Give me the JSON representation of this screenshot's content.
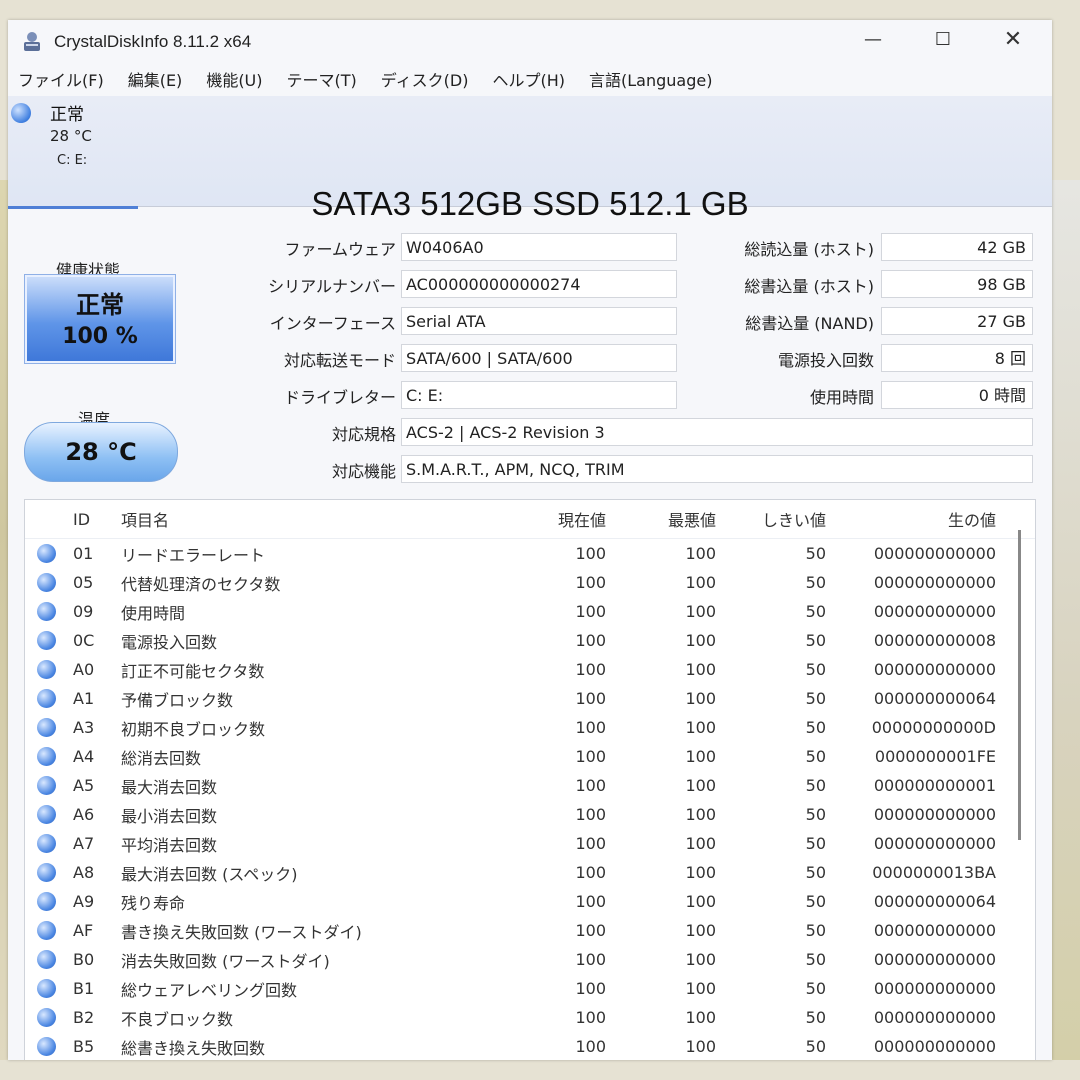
{
  "window": {
    "title": "CrystalDiskInfo 8.11.2 x64",
    "minimize": "—",
    "maximize": "☐",
    "close": "✕"
  },
  "menu": [
    "ファイル(F)",
    "編集(E)",
    "機能(U)",
    "テーマ(T)",
    "ディスク(D)",
    "ヘルプ(H)",
    "言語(Language)"
  ],
  "disk_tab": {
    "status": "正常",
    "temp": "28 °C",
    "letters": "C: E:"
  },
  "model": "SATA3 512GB SSD 512.1 GB",
  "health": {
    "label": "健康状態",
    "status": "正常",
    "percent": "100 %"
  },
  "temperature": {
    "label": "温度",
    "value": "28 °C"
  },
  "info_left": {
    "firmware_label": "ファームウェア",
    "firmware": "W0406A0",
    "serial_label": "シリアルナンバー",
    "serial": "AC000000000000274",
    "interface_label": "インターフェース",
    "interface": "Serial ATA",
    "transfer_label": "対応転送モード",
    "transfer": "SATA/600 | SATA/600",
    "drive_label": "ドライブレター",
    "drive": "C: E:",
    "standard_label": "対応規格",
    "standard": "ACS-2 | ACS-2 Revision 3",
    "features_label": "対応機能",
    "features": "S.M.A.R.T., APM, NCQ, TRIM"
  },
  "info_right": {
    "host_reads_label": "総読込量 (ホスト)",
    "host_reads": "42 GB",
    "host_writes_label": "総書込量 (ホスト)",
    "host_writes": "98 GB",
    "nand_writes_label": "総書込量 (NAND)",
    "nand_writes": "27 GB",
    "power_count_label": "電源投入回数",
    "power_count": "8 回",
    "power_hours_label": "使用時間",
    "power_hours": "0 時間"
  },
  "smart_headers": {
    "id": "ID",
    "name": "項目名",
    "current": "現在値",
    "worst": "最悪値",
    "threshold": "しきい値",
    "raw": "生の値"
  },
  "smart_rows": [
    {
      "id": "01",
      "name": "リードエラーレート",
      "current": "100",
      "worst": "100",
      "threshold": "50",
      "raw": "000000000000"
    },
    {
      "id": "05",
      "name": "代替処理済のセクタ数",
      "current": "100",
      "worst": "100",
      "threshold": "50",
      "raw": "000000000000"
    },
    {
      "id": "09",
      "name": "使用時間",
      "current": "100",
      "worst": "100",
      "threshold": "50",
      "raw": "000000000000"
    },
    {
      "id": "0C",
      "name": "電源投入回数",
      "current": "100",
      "worst": "100",
      "threshold": "50",
      "raw": "000000000008"
    },
    {
      "id": "A0",
      "name": "訂正不可能セクタ数",
      "current": "100",
      "worst": "100",
      "threshold": "50",
      "raw": "000000000000"
    },
    {
      "id": "A1",
      "name": "予備ブロック数",
      "current": "100",
      "worst": "100",
      "threshold": "50",
      "raw": "000000000064"
    },
    {
      "id": "A3",
      "name": "初期不良ブロック数",
      "current": "100",
      "worst": "100",
      "threshold": "50",
      "raw": "00000000000D"
    },
    {
      "id": "A4",
      "name": "総消去回数",
      "current": "100",
      "worst": "100",
      "threshold": "50",
      "raw": "0000000001FE"
    },
    {
      "id": "A5",
      "name": "最大消去回数",
      "current": "100",
      "worst": "100",
      "threshold": "50",
      "raw": "000000000001"
    },
    {
      "id": "A6",
      "name": "最小消去回数",
      "current": "100",
      "worst": "100",
      "threshold": "50",
      "raw": "000000000000"
    },
    {
      "id": "A7",
      "name": "平均消去回数",
      "current": "100",
      "worst": "100",
      "threshold": "50",
      "raw": "000000000000"
    },
    {
      "id": "A8",
      "name": "最大消去回数 (スペック)",
      "current": "100",
      "worst": "100",
      "threshold": "50",
      "raw": "0000000013BA"
    },
    {
      "id": "A9",
      "name": "残り寿命",
      "current": "100",
      "worst": "100",
      "threshold": "50",
      "raw": "000000000064"
    },
    {
      "id": "AF",
      "name": "書き換え失敗回数 (ワーストダイ)",
      "current": "100",
      "worst": "100",
      "threshold": "50",
      "raw": "000000000000"
    },
    {
      "id": "B0",
      "name": "消去失敗回数 (ワーストダイ)",
      "current": "100",
      "worst": "100",
      "threshold": "50",
      "raw": "000000000000"
    },
    {
      "id": "B1",
      "name": "総ウェアレベリング回数",
      "current": "100",
      "worst": "100",
      "threshold": "50",
      "raw": "000000000000"
    },
    {
      "id": "B2",
      "name": "不良ブロック数",
      "current": "100",
      "worst": "100",
      "threshold": "50",
      "raw": "000000000000"
    },
    {
      "id": "B5",
      "name": "総書き換え失敗回数",
      "current": "100",
      "worst": "100",
      "threshold": "50",
      "raw": "000000000000"
    }
  ],
  "colors": {
    "good": "#3f7fe0",
    "accent": "#4f7fd6"
  }
}
